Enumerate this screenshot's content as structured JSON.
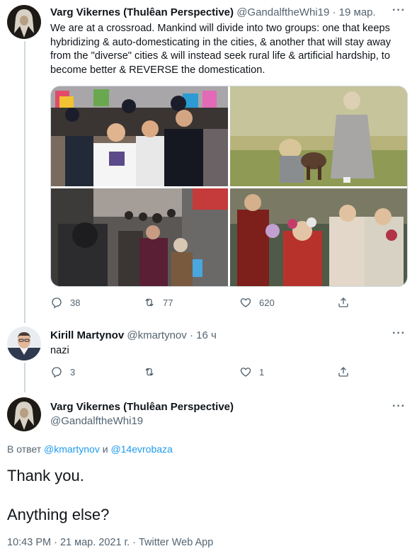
{
  "tweet1": {
    "name": "Varg Vikernes (Thulêan Perspective)",
    "handle": "@GandalftheWhi19",
    "separator": "·",
    "time": "19 мар.",
    "text": "We are at a crossroad. Mankind will divide into two groups: one that keeps hybridizing & auto-domesticating in the cities, & another that will stay away from the \"diverse\" cities & will instead seek rural life & artificial hardship, to become better & REVERSE the domestication.",
    "more": "···",
    "replies": "38",
    "retweets": "77",
    "likes": "620",
    "media_placeholder": {
      "t1": "pride-parade-photo",
      "t2": "children-with-goat-photo",
      "t3": "city-street-crowd-photo",
      "t4": "girls-with-flower-wreaths-painting"
    }
  },
  "tweet2": {
    "name": "Kirill Martynov",
    "handle": "@kmartynov",
    "separator": "·",
    "time": "16 ч",
    "text": "nazi",
    "more": "···",
    "replies": "3",
    "retweets": "",
    "likes": "1"
  },
  "tweet3": {
    "name": "Varg Vikernes (Thulêan Perspective)",
    "handle": "@GandalftheWhi19",
    "more": "···",
    "reply_prefix": "В ответ ",
    "mention1": "@kmartynov",
    "reply_and": " и ",
    "mention2": "@14evrobaza",
    "line1": "Thank you.",
    "line2": "Anything else?",
    "timestamp": "10:43 PM · 21 мар. 2021 г. · Twitter Web App"
  },
  "colors": {
    "text": "#0f1419",
    "secondary": "#536471",
    "link": "#1d9bf0",
    "line": "#cfd9de"
  }
}
